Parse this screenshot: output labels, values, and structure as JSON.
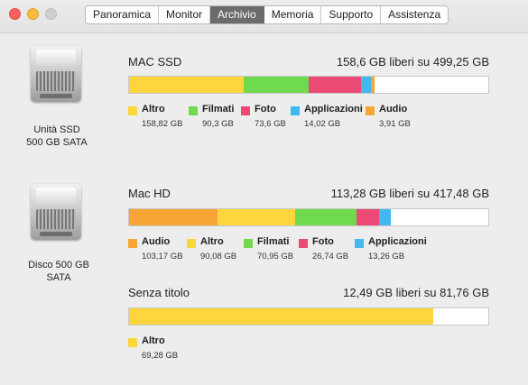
{
  "window": {
    "tabs": [
      {
        "label": "Panoramica",
        "active": false
      },
      {
        "label": "Monitor",
        "active": false
      },
      {
        "label": "Archivio",
        "active": true
      },
      {
        "label": "Memoria",
        "active": false
      },
      {
        "label": "Supporto",
        "active": false
      },
      {
        "label": "Assistenza",
        "active": false
      }
    ]
  },
  "colors": {
    "altro": "#fdd63e",
    "filmati": "#6fda4e",
    "foto": "#ea4a74",
    "applicazioni": "#40b9f0",
    "audio": "#f7a534"
  },
  "disks": [
    {
      "name_line1": "Unità SSD",
      "name_line2": "500 GB SATA",
      "volumes": [
        {
          "name": "MAC SSD",
          "free_text": "158,6 GB liberi su 499,25 GB",
          "total_gb": 499.25,
          "categories": [
            {
              "label": "Altro",
              "value": "158,82 GB",
              "gb": 158.82,
              "color": "#fdd63e"
            },
            {
              "label": "Filmati",
              "value": "90,3 GB",
              "gb": 90.3,
              "color": "#6fda4e"
            },
            {
              "label": "Foto",
              "value": "73,6 GB",
              "gb": 73.6,
              "color": "#ea4a74"
            },
            {
              "label": "Applicazioni",
              "value": "14,02 GB",
              "gb": 14.02,
              "color": "#40b9f0"
            },
            {
              "label": "Audio",
              "value": "3,91 GB",
              "gb": 3.91,
              "color": "#f7a534"
            }
          ]
        }
      ]
    },
    {
      "name_line1": "Disco 500 GB",
      "name_line2": "SATA",
      "volumes": [
        {
          "name": "Mac HD",
          "free_text": "113,28 GB liberi su 417,48 GB",
          "total_gb": 417.48,
          "categories": [
            {
              "label": "Audio",
              "value": "103,17 GB",
              "gb": 103.17,
              "color": "#f7a534"
            },
            {
              "label": "Altro",
              "value": "90,08 GB",
              "gb": 90.08,
              "color": "#fdd63e"
            },
            {
              "label": "Filmati",
              "value": "70,95 GB",
              "gb": 70.95,
              "color": "#6fda4e"
            },
            {
              "label": "Foto",
              "value": "26,74 GB",
              "gb": 26.74,
              "color": "#ea4a74"
            },
            {
              "label": "Applicazioni",
              "value": "13,26 GB",
              "gb": 13.26,
              "color": "#40b9f0"
            }
          ]
        },
        {
          "name": "Senza titolo",
          "free_text": "12,49 GB liberi su 81,76 GB",
          "total_gb": 81.76,
          "categories": [
            {
              "label": "Altro",
              "value": "69,28 GB",
              "gb": 69.28,
              "color": "#fdd63e"
            }
          ]
        }
      ]
    }
  ]
}
